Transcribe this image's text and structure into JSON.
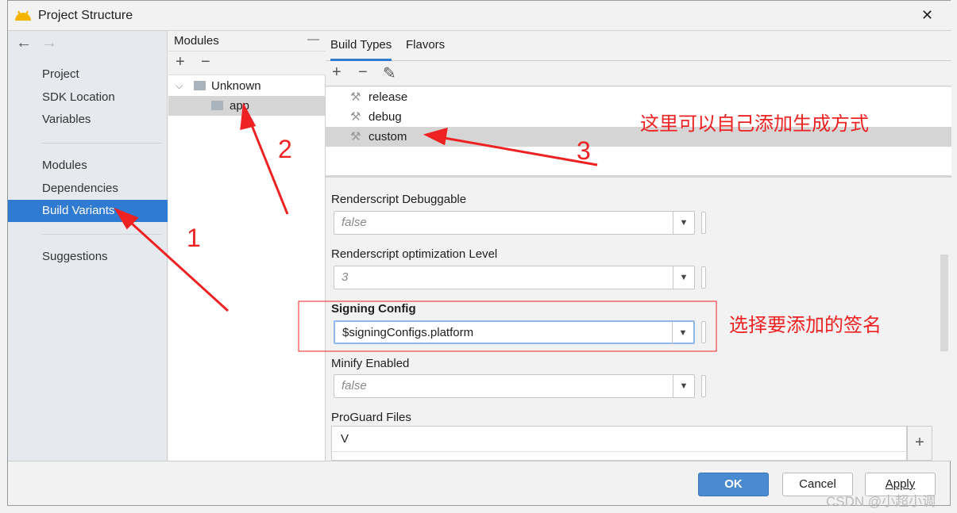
{
  "window": {
    "title": "Project Structure",
    "close": "✕"
  },
  "sidebar": {
    "back": "←",
    "forward": "→",
    "items": [
      {
        "label": "Project"
      },
      {
        "label": "SDK Location"
      },
      {
        "label": "Variables"
      },
      {
        "label": "Modules"
      },
      {
        "label": "Dependencies"
      },
      {
        "label": "Build Variants",
        "selected": true
      },
      {
        "label": "Suggestions"
      }
    ]
  },
  "modules": {
    "header": "Modules",
    "collapse": "—",
    "add": "+",
    "remove": "−",
    "tree": [
      {
        "label": "Unknown",
        "expanded": true
      },
      {
        "label": "app",
        "selected": true
      }
    ]
  },
  "build": {
    "tabs": [
      {
        "label": "Build Types",
        "active": true
      },
      {
        "label": "Flavors"
      }
    ],
    "add": "+",
    "remove": "−",
    "edit": "✎",
    "types": [
      {
        "label": "release"
      },
      {
        "label": "debug"
      },
      {
        "label": "custom",
        "selected": true
      }
    ]
  },
  "form": {
    "fields": [
      {
        "label": "Renderscript Debuggable",
        "value": "false"
      },
      {
        "label": "Renderscript optimization Level",
        "value": "3"
      },
      {
        "label": "Signing Config",
        "value": "$signingConfigs.platform"
      },
      {
        "label": "Minify Enabled",
        "value": "false"
      }
    ],
    "proguard": {
      "label": "ProGuard Files",
      "value": "V",
      "add": "+"
    }
  },
  "footer": {
    "ok": "OK",
    "cancel": "Cancel",
    "apply": "Apply"
  },
  "annotations": {
    "n1": "1",
    "n2": "2",
    "n3": "3",
    "note_types": "这里可以自己添加生成方式",
    "note_signing": "选择要添加的签名",
    "color": "#ee2222"
  },
  "watermark": "CSDN @小超小调",
  "colors": {
    "accent": "#2f7bd3",
    "ok_button": "#4a8ad0"
  }
}
